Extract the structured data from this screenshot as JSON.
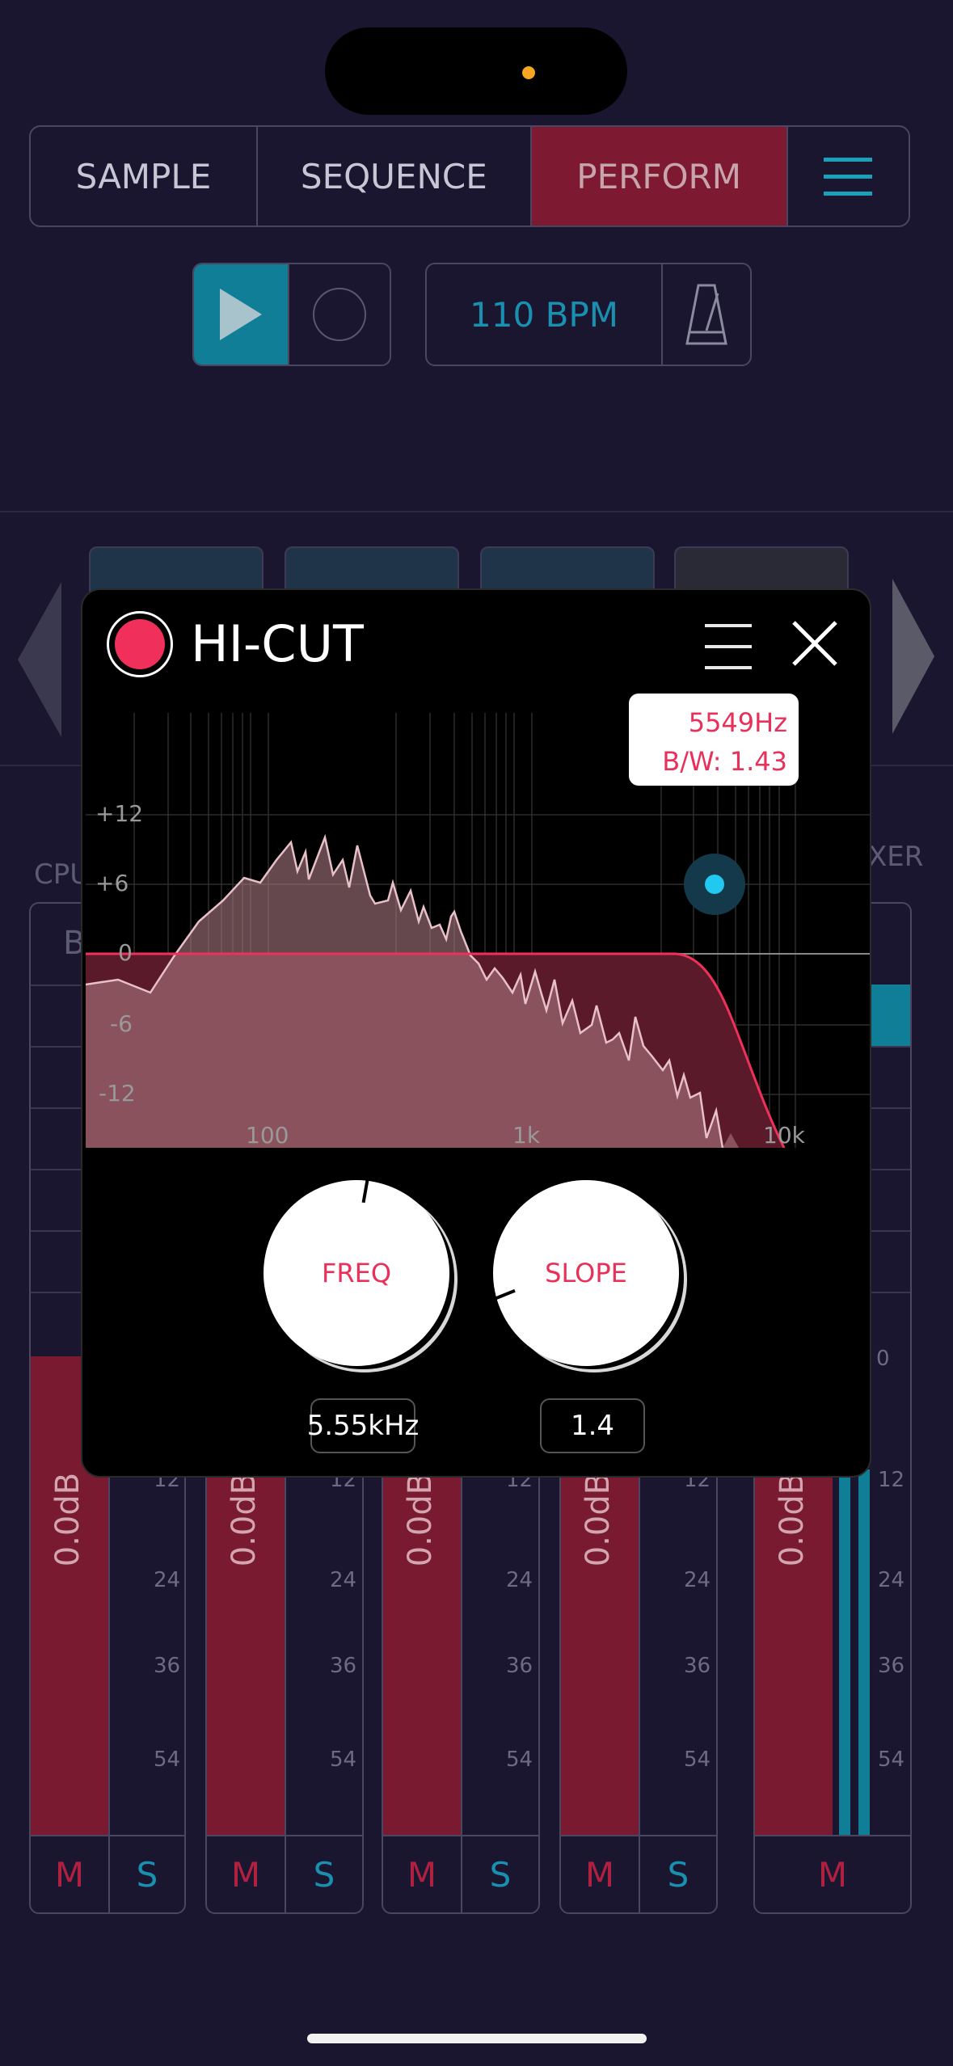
{
  "nav": {
    "tabs": [
      "SAMPLE",
      "SEQUENCE",
      "PERFORM"
    ],
    "active_tab": "PERFORM"
  },
  "transport": {
    "bpm": "110 BPM"
  },
  "side_labels": {
    "left": "CPU",
    "right": "XER",
    "channel_b": "B"
  },
  "channels": [
    {
      "level": "0.0dB",
      "mute": "M",
      "solo": "S"
    },
    {
      "level": "0.0dB",
      "mute": "M",
      "solo": "S"
    },
    {
      "level": "0.0dB",
      "mute": "M",
      "solo": "S"
    },
    {
      "level": "0.0dB",
      "mute": "M",
      "solo": "S"
    },
    {
      "level": "0.0dB",
      "mute": "M"
    }
  ],
  "meter_scale": [
    "12",
    "24",
    "36",
    "54"
  ],
  "meter_top_mark": "0",
  "effect": {
    "title": "HI-CUT",
    "tooltip": {
      "freq": "5549Hz",
      "bw": "B/W: 1.43"
    },
    "db_labels": [
      "+12",
      "+6",
      "0",
      "-6",
      "-12"
    ],
    "freq_labels": [
      "100",
      "1k",
      "10k"
    ],
    "knobs": [
      {
        "label": "FREQ",
        "value": "5.55kHz"
      },
      {
        "label": "SLOPE",
        "value": "1.4"
      }
    ]
  },
  "colors": {
    "accent_red": "#e8305a",
    "teal": "#1a90b0",
    "perform_red": "#7d1a32",
    "bg": "#1a1630"
  }
}
